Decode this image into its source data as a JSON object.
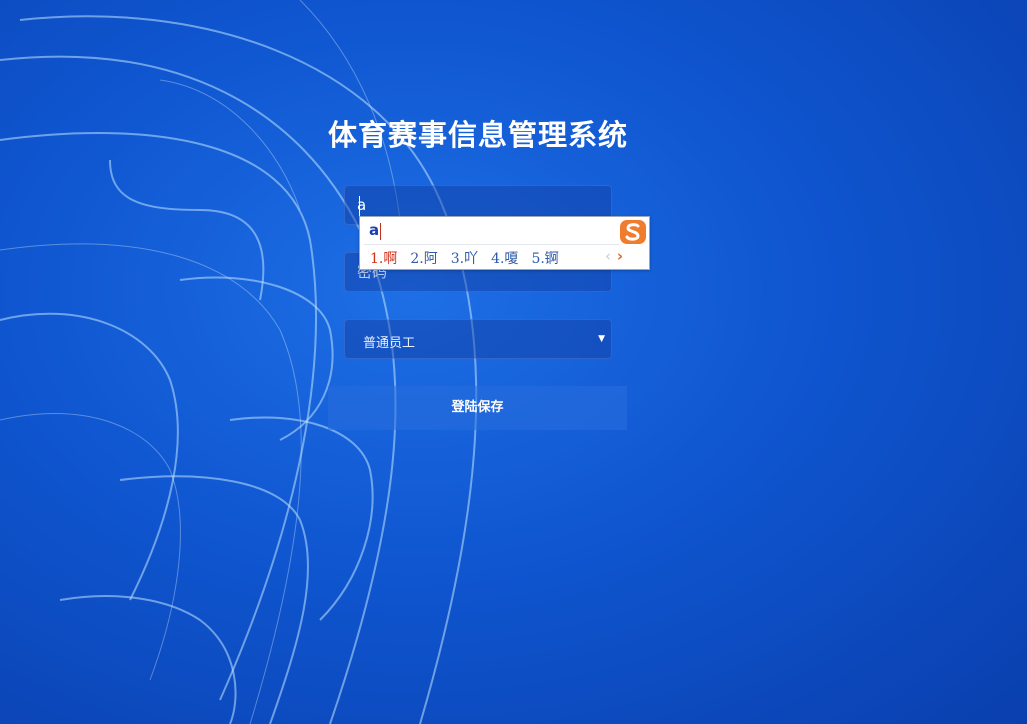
{
  "app": {
    "title": "体育赛事信息管理系统"
  },
  "form": {
    "username": {
      "value": "a",
      "placeholder": ""
    },
    "password": {
      "placeholder": "密码"
    },
    "role_select": {
      "selected": "普通员工"
    },
    "login_button": "登陆保存"
  },
  "ime": {
    "composition": "a",
    "candidates": [
      "1.啊",
      "2.阿",
      "3.吖",
      "4.嗄",
      "5.锕"
    ],
    "prev_symbol": "‹",
    "next_symbol": "›"
  },
  "colors": {
    "background": "#0f56d0",
    "ime_highlight": "#d0301c",
    "ime_logo": "#f07c2e"
  }
}
